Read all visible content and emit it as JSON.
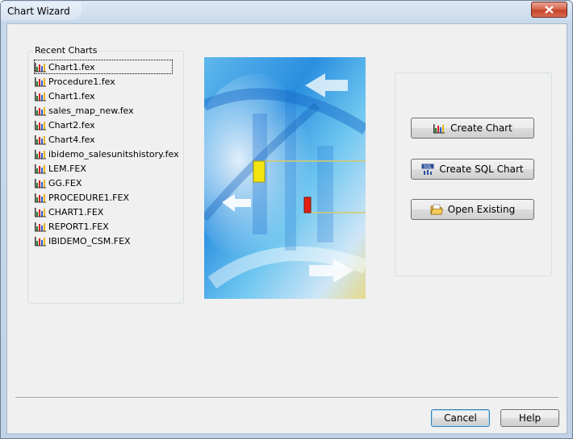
{
  "window": {
    "title": "Chart Wizard"
  },
  "recent_charts": {
    "legend": "Recent Charts",
    "items": [
      {
        "label": "Chart1.fex",
        "selected": true
      },
      {
        "label": "Procedure1.fex"
      },
      {
        "label": "Chart1.fex"
      },
      {
        "label": "sales_map_new.fex"
      },
      {
        "label": "Chart2.fex"
      },
      {
        "label": "Chart4.fex"
      },
      {
        "label": "ibidemo_salesunitshistory.fex"
      },
      {
        "label": "LEM.FEX"
      },
      {
        "label": "GG.FEX"
      },
      {
        "label": "PROCEDURE1.FEX"
      },
      {
        "label": "CHART1.FEX"
      },
      {
        "label": "REPORT1.FEX"
      },
      {
        "label": "IBIDEMO_CSM.FEX"
      }
    ]
  },
  "actions": {
    "create_chart": "Create Chart",
    "create_sql_chart": "Create SQL Chart",
    "open_existing": "Open Existing"
  },
  "footer": {
    "cancel": "Cancel",
    "help": "Help"
  },
  "icons": {
    "chart_file": "bar-chart-icon",
    "sql": "sql-chart-icon",
    "open": "open-folder-icon",
    "close": "close-icon"
  },
  "colors": {
    "accent": "#3c7fb1",
    "close_button": "#c7432a"
  }
}
